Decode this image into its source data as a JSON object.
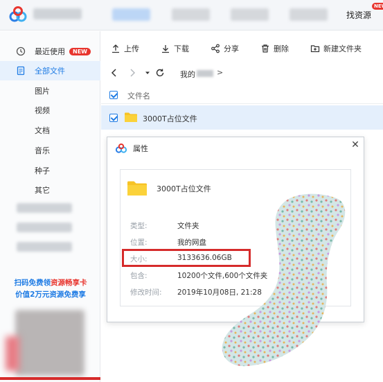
{
  "topbar": {
    "find_resources": "找资源",
    "new_corner": "NEW"
  },
  "sidebar": {
    "recent_label": "最近使用",
    "recent_badge": "NEW",
    "all_files_label": "全部文件",
    "categories": [
      "图片",
      "视频",
      "文档",
      "音乐",
      "种子",
      "其它"
    ],
    "promo_line1_a": "扫码免费领",
    "promo_line1_b": "资源畅享卡",
    "promo_line2": "价值2万元资源免费享"
  },
  "toolbar": {
    "upload": "上传",
    "download": "下载",
    "share": "分享",
    "delete": "删除",
    "new_folder": "新建文件夹"
  },
  "address": {
    "crumb": "我的",
    "crumb_arrow": ">"
  },
  "file_list": {
    "column_name": "文件名",
    "rows": [
      {
        "name": "3000T占位文件",
        "checked": true
      }
    ]
  },
  "dialog": {
    "title": "属性",
    "close": "✕",
    "file_name": "3000T占位文件",
    "properties": [
      {
        "label": "类型:",
        "value": "文件夹"
      },
      {
        "label": "位置:",
        "value": "我的网盘"
      },
      {
        "label": "大小:",
        "value": "3133636.06GB"
      },
      {
        "label": "包含:",
        "value": "10200个文件,600个文件夹"
      },
      {
        "label": "修改时间:",
        "value": "2019年10月08日, 21:28"
      }
    ]
  },
  "colors": {
    "accent": "#1e7be4",
    "badge_red": "#e8352e",
    "highlight_red": "#d62b2b",
    "folder_yellow": "#f7c325"
  }
}
